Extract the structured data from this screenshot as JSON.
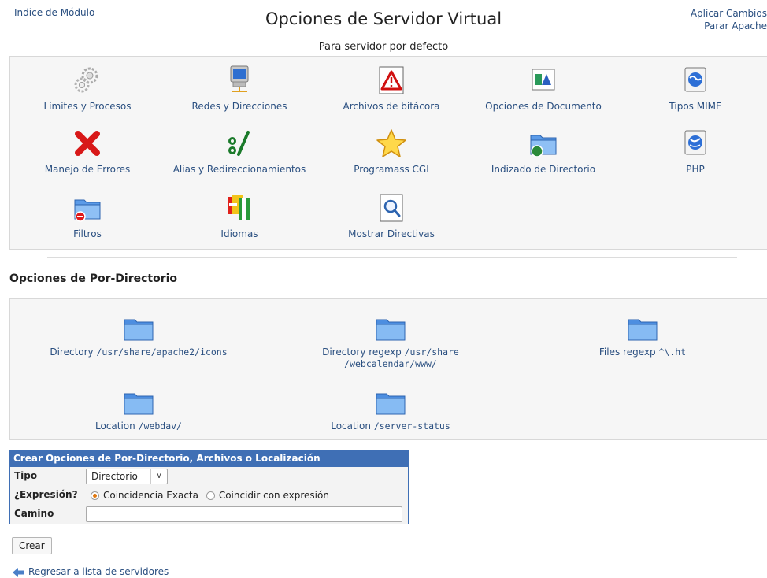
{
  "header": {
    "index_link": "Indice de Módulo",
    "title": "Opciones de Servidor Virtual",
    "subtitle": "Para servidor por defecto",
    "apply_link": "Aplicar Cambios",
    "stop_link": "Parar Apache"
  },
  "icons": [
    {
      "label": "Límites y Procesos",
      "icon": "gears-icon"
    },
    {
      "label": "Redes y Direcciones",
      "icon": "network-computer-icon"
    },
    {
      "label": "Archivos de bitácora",
      "icon": "warning-log-icon"
    },
    {
      "label": "Opciones de Documento",
      "icon": "document-options-icon"
    },
    {
      "label": "Tipos MIME",
      "icon": "globe-mime-icon"
    },
    {
      "label": "Manejo de Errores",
      "icon": "red-x-icon"
    },
    {
      "label": "Alias y Redireccionamientos",
      "icon": "alias-slash-icon"
    },
    {
      "label": "Programass CGI",
      "icon": "star-icon"
    },
    {
      "label": "Indizado de Directorio",
      "icon": "folder-globe-icon"
    },
    {
      "label": "PHP",
      "icon": "php-globe-icon"
    },
    {
      "label": "Filtros",
      "icon": "folder-filter-icon"
    },
    {
      "label": "Idiomas",
      "icon": "flags-icon"
    },
    {
      "label": "Mostrar Directivas",
      "icon": "magnifier-icon"
    }
  ],
  "per_directory": {
    "title": "Opciones de Por-Directorio",
    "items": [
      {
        "kind": "Directory",
        "path": "/usr/share/apache2/icons"
      },
      {
        "kind": "Directory regexp",
        "path": "/usr/share",
        "path2": "/webcalendar/www/"
      },
      {
        "kind": "Files regexp",
        "path": "^\\.ht"
      },
      {
        "kind": "Location",
        "path": "/webdav/"
      },
      {
        "kind": "Location",
        "path": "/server-status"
      }
    ]
  },
  "form": {
    "header": "Crear Opciones de Por-Directorio, Archivos o Localización",
    "tipo_label": "Tipo",
    "tipo_value": "Directorio",
    "expr_label": "¿Expresión?",
    "expr_option_exact": "Coincidencia Exacta",
    "expr_option_regex": "Coincidir con expresión",
    "expr_selected": "exact",
    "camino_label": "Camino",
    "camino_value": "",
    "create_button": "Crear"
  },
  "footer": {
    "back_link": "Regresar a lista de servidores"
  },
  "colors": {
    "link": "#2a4f80",
    "form_header": "#3f6fb5",
    "radio_selected": "#e07810"
  }
}
